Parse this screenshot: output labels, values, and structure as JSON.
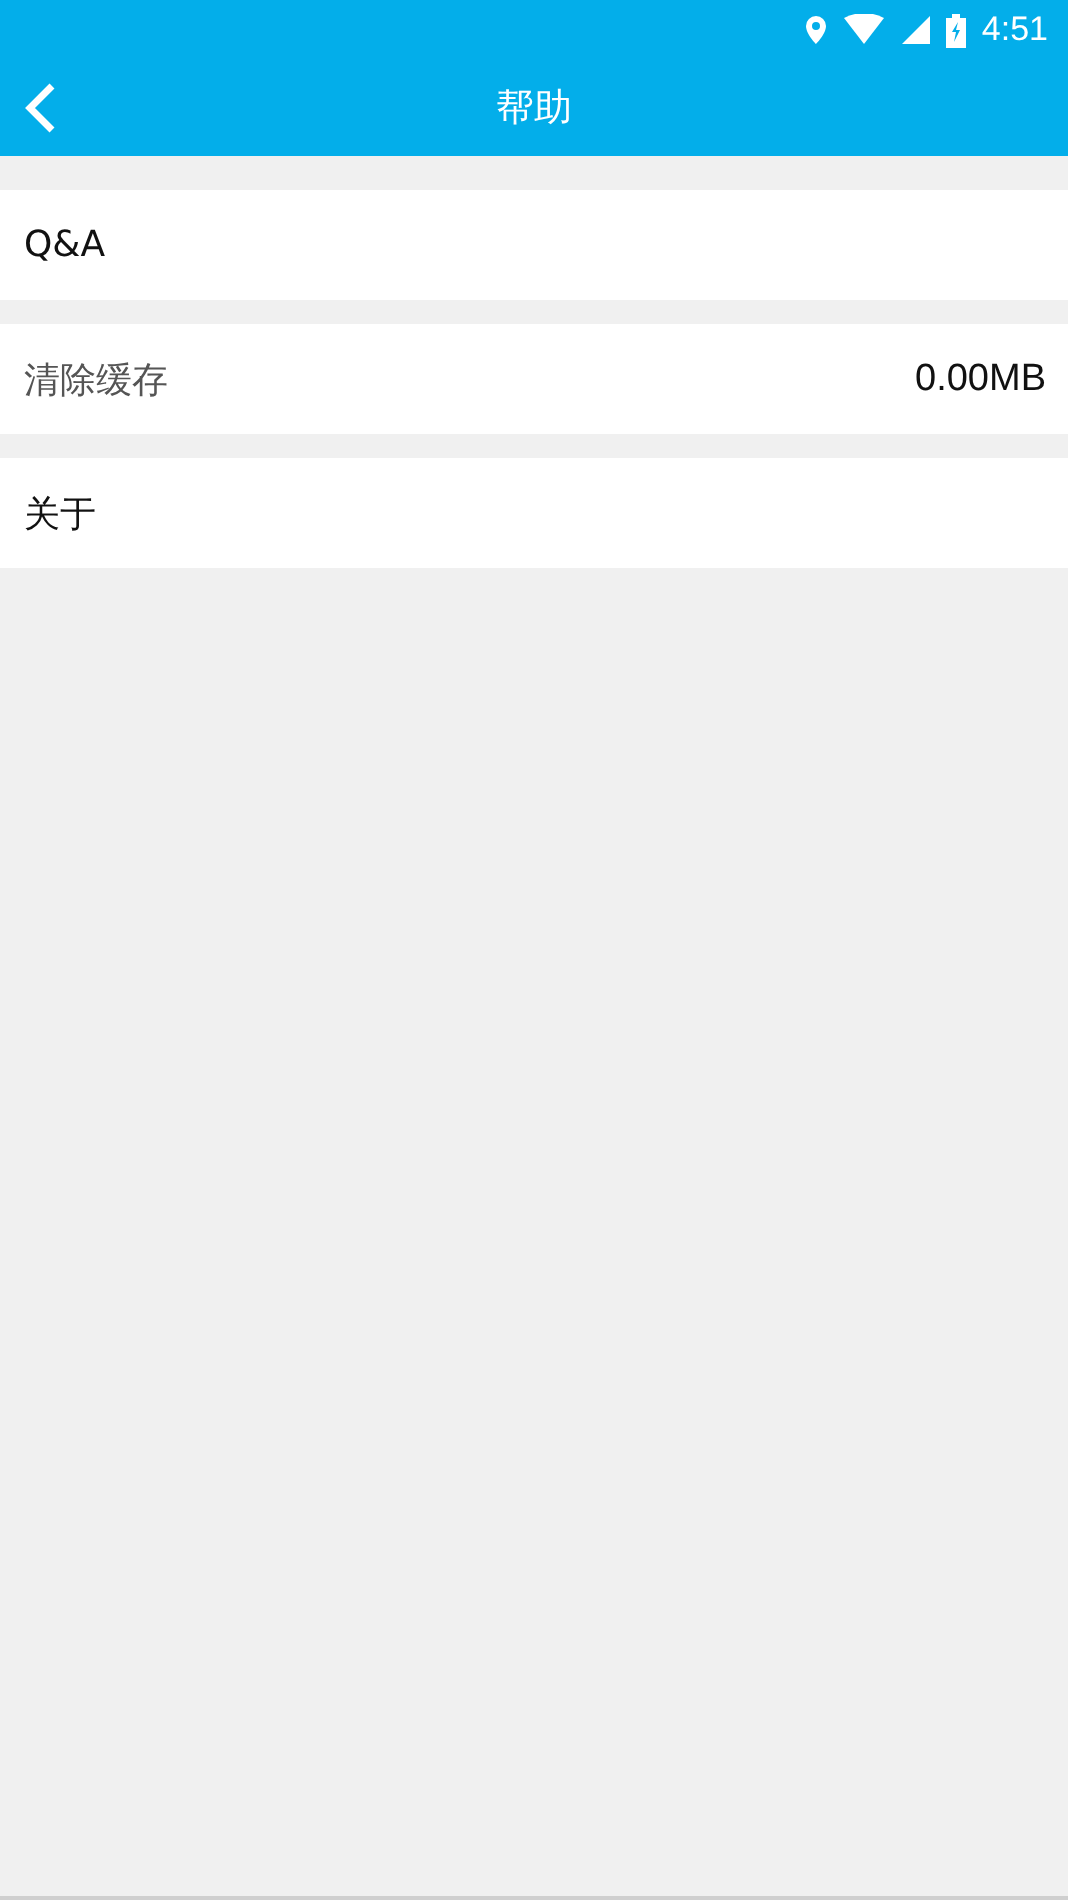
{
  "status_bar": {
    "time": "4:51"
  },
  "app_bar": {
    "title": "帮助"
  },
  "items": [
    {
      "kind": "link",
      "label": "Q&A"
    },
    {
      "kind": "value",
      "label": "清除缓存",
      "value": "0.00MB"
    },
    {
      "kind": "link",
      "label": "关于"
    }
  ]
}
